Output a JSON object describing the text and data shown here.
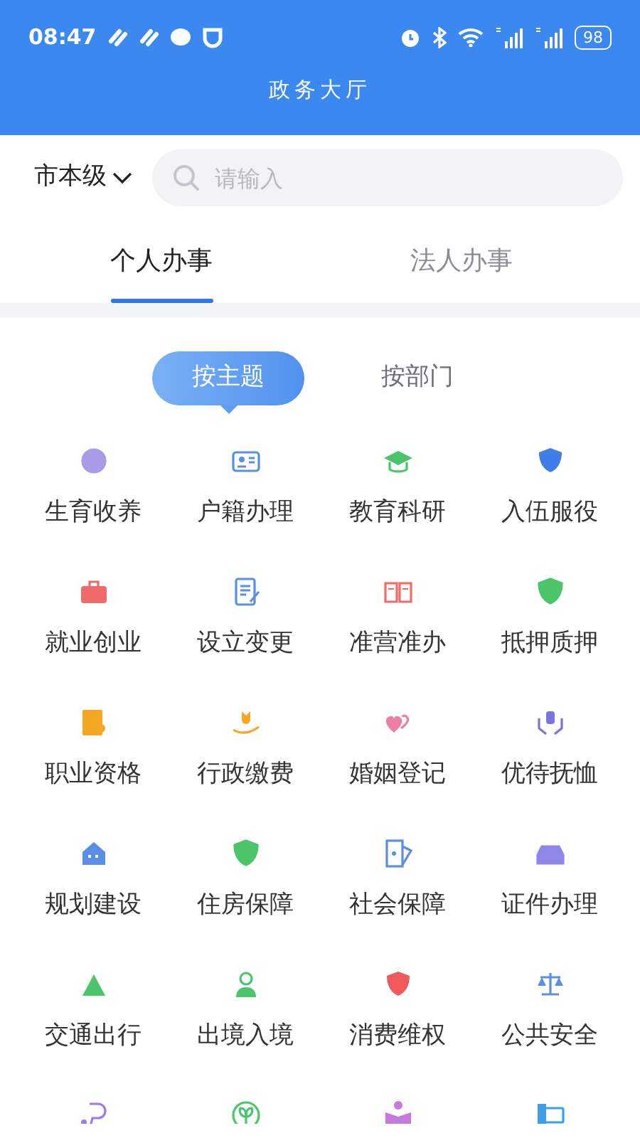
{
  "status_bar": {
    "time": "08:47",
    "battery": "98"
  },
  "header": {
    "title": "政务大厅"
  },
  "region": {
    "label": "市本级"
  },
  "search": {
    "placeholder": "请输入"
  },
  "tabs": [
    {
      "label": "个人办事",
      "selected": true
    },
    {
      "label": "法人办事",
      "selected": false
    }
  ],
  "sub_tabs": [
    {
      "label": "按主题",
      "selected": true
    },
    {
      "label": "按部门",
      "selected": false
    }
  ],
  "services": [
    {
      "label": "生育收养",
      "color": "#a99be8"
    },
    {
      "label": "户籍办理",
      "color": "#5b8fe6"
    },
    {
      "label": "教育科研",
      "color": "#4cc46a"
    },
    {
      "label": "入伍服役",
      "color": "#3f7ee8"
    },
    {
      "label": "就业创业",
      "color": "#ef6b6b"
    },
    {
      "label": "设立变更",
      "color": "#5b8fe6"
    },
    {
      "label": "准营准办",
      "color": "#ef6b6b"
    },
    {
      "label": "抵押质押",
      "color": "#4cc46a"
    },
    {
      "label": "职业资格",
      "color": "#f5a623"
    },
    {
      "label": "行政缴费",
      "color": "#f5a623"
    },
    {
      "label": "婚姻登记",
      "color": "#f07ea0"
    },
    {
      "label": "优待抚恤",
      "color": "#7b73e0"
    },
    {
      "label": "规划建设",
      "color": "#5b8fe6"
    },
    {
      "label": "住房保障",
      "color": "#4cc46a"
    },
    {
      "label": "社会保障",
      "color": "#5b8fe6"
    },
    {
      "label": "证件办理",
      "color": "#8f86e8"
    },
    {
      "label": "交通出行",
      "color": "#4cc46a"
    },
    {
      "label": "出境入境",
      "color": "#4cc46a"
    },
    {
      "label": "消费维权",
      "color": "#ef5a5a"
    },
    {
      "label": "公共安全",
      "color": "#5b8fe6"
    },
    {
      "color": "#9b7be8"
    },
    {
      "color": "#4cc46a"
    },
    {
      "color": "#c47be0"
    },
    {
      "color": "#3f9ee8"
    }
  ]
}
